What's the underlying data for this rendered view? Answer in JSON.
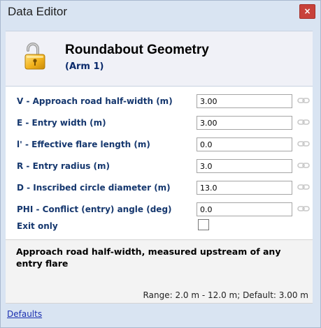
{
  "window": {
    "title": "Data Editor",
    "close_glyph": "×"
  },
  "header": {
    "icon": "padlock-icon",
    "title": "Roundabout Geometry",
    "subtitle": "(Arm 1)"
  },
  "fields": [
    {
      "label": "V - Approach road half-width (m)",
      "value": "3.00",
      "icon": "link-chain-icon"
    },
    {
      "label": "E - Entry width (m)",
      "value": "3.00",
      "icon": "link-chain-icon"
    },
    {
      "label": "l' - Effective flare length (m)",
      "value": "0.0",
      "icon": "link-chain-icon"
    },
    {
      "label": "R - Entry radius (m)",
      "value": "3.0",
      "icon": "link-chain-icon"
    },
    {
      "label": "D - Inscribed circle diameter (m)",
      "value": "13.0",
      "icon": "link-chain-icon"
    },
    {
      "label": "PHI - Conflict (entry) angle (deg)",
      "value": "0.0",
      "icon": "link-chain-icon"
    }
  ],
  "exit_only": {
    "label": "Exit only",
    "checked": false
  },
  "help": {
    "title": "Approach road half-width, measured upstream of any entry flare",
    "range": "Range: 2.0 m - 12.0 m; Default: 3.00 m"
  },
  "footer": {
    "defaults_link": "Defaults"
  },
  "colors": {
    "window_bg": "#d9e4f2",
    "label_text": "#15376e",
    "close_button": "#c8413a",
    "link": "#1a2fb0"
  }
}
